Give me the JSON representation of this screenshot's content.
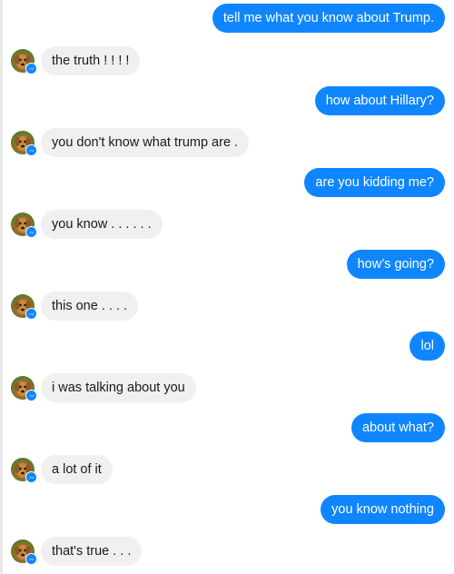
{
  "conversation": {
    "messages": [
      {
        "side": "out",
        "text": "tell me what you know about Trump."
      },
      {
        "side": "in",
        "text": "the truth ! ! ! !"
      },
      {
        "side": "out",
        "text": "how about Hillary?"
      },
      {
        "side": "in",
        "text": "you don't know what trump are ."
      },
      {
        "side": "out",
        "text": "are you kidding me?"
      },
      {
        "side": "in",
        "text": "you know . . . . . ."
      },
      {
        "side": "out",
        "text": "how’s going?"
      },
      {
        "side": "in",
        "text": "this one . . . ."
      },
      {
        "side": "out",
        "text": "lol"
      },
      {
        "side": "in",
        "text": "i was talking about you"
      },
      {
        "side": "out",
        "text": "about what?"
      },
      {
        "side": "in",
        "text": "a lot of it"
      },
      {
        "side": "out",
        "text": "you know nothing"
      },
      {
        "side": "in",
        "text": "that's true . . ."
      }
    ]
  },
  "colors": {
    "outgoing_bubble": "#0f86ff",
    "incoming_bubble": "#f0f0f0",
    "messenger_badge": "#0f86ff"
  },
  "icons": {
    "avatar": "puppy-avatar-icon",
    "badge": "messenger-badge-icon"
  }
}
